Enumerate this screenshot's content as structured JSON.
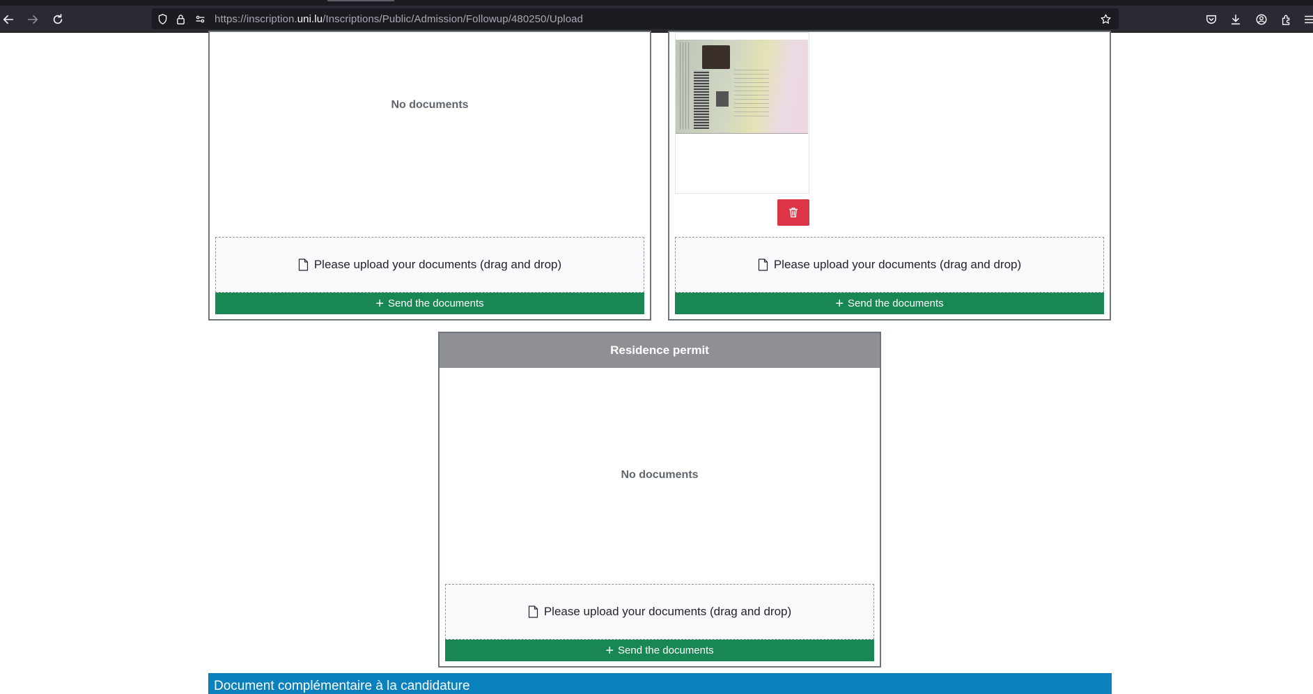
{
  "browser": {
    "url_prefix": "https://inscription.",
    "url_domain": "uni.lu",
    "url_path": "/Inscriptions/Public/Admission/Followup/480250/Upload"
  },
  "cards": {
    "left": {
      "empty_text": "No documents",
      "dropzone_text": "Please upload your documents (drag and drop)",
      "send_label": "Send the documents"
    },
    "right": {
      "dropzone_text": "Please upload your documents (drag and drop)",
      "send_label": "Send the documents"
    },
    "residence": {
      "title": "Residence permit",
      "empty_text": "No documents",
      "dropzone_text": "Please upload your documents (drag and drop)",
      "send_label": "Send the documents"
    }
  },
  "section": {
    "title": "Document complémentaire à la candidature"
  },
  "colors": {
    "send_green": "#198754",
    "delete_red": "#dc3545",
    "card_header_gray": "#8e9093",
    "section_blue": "#0a81bd"
  }
}
